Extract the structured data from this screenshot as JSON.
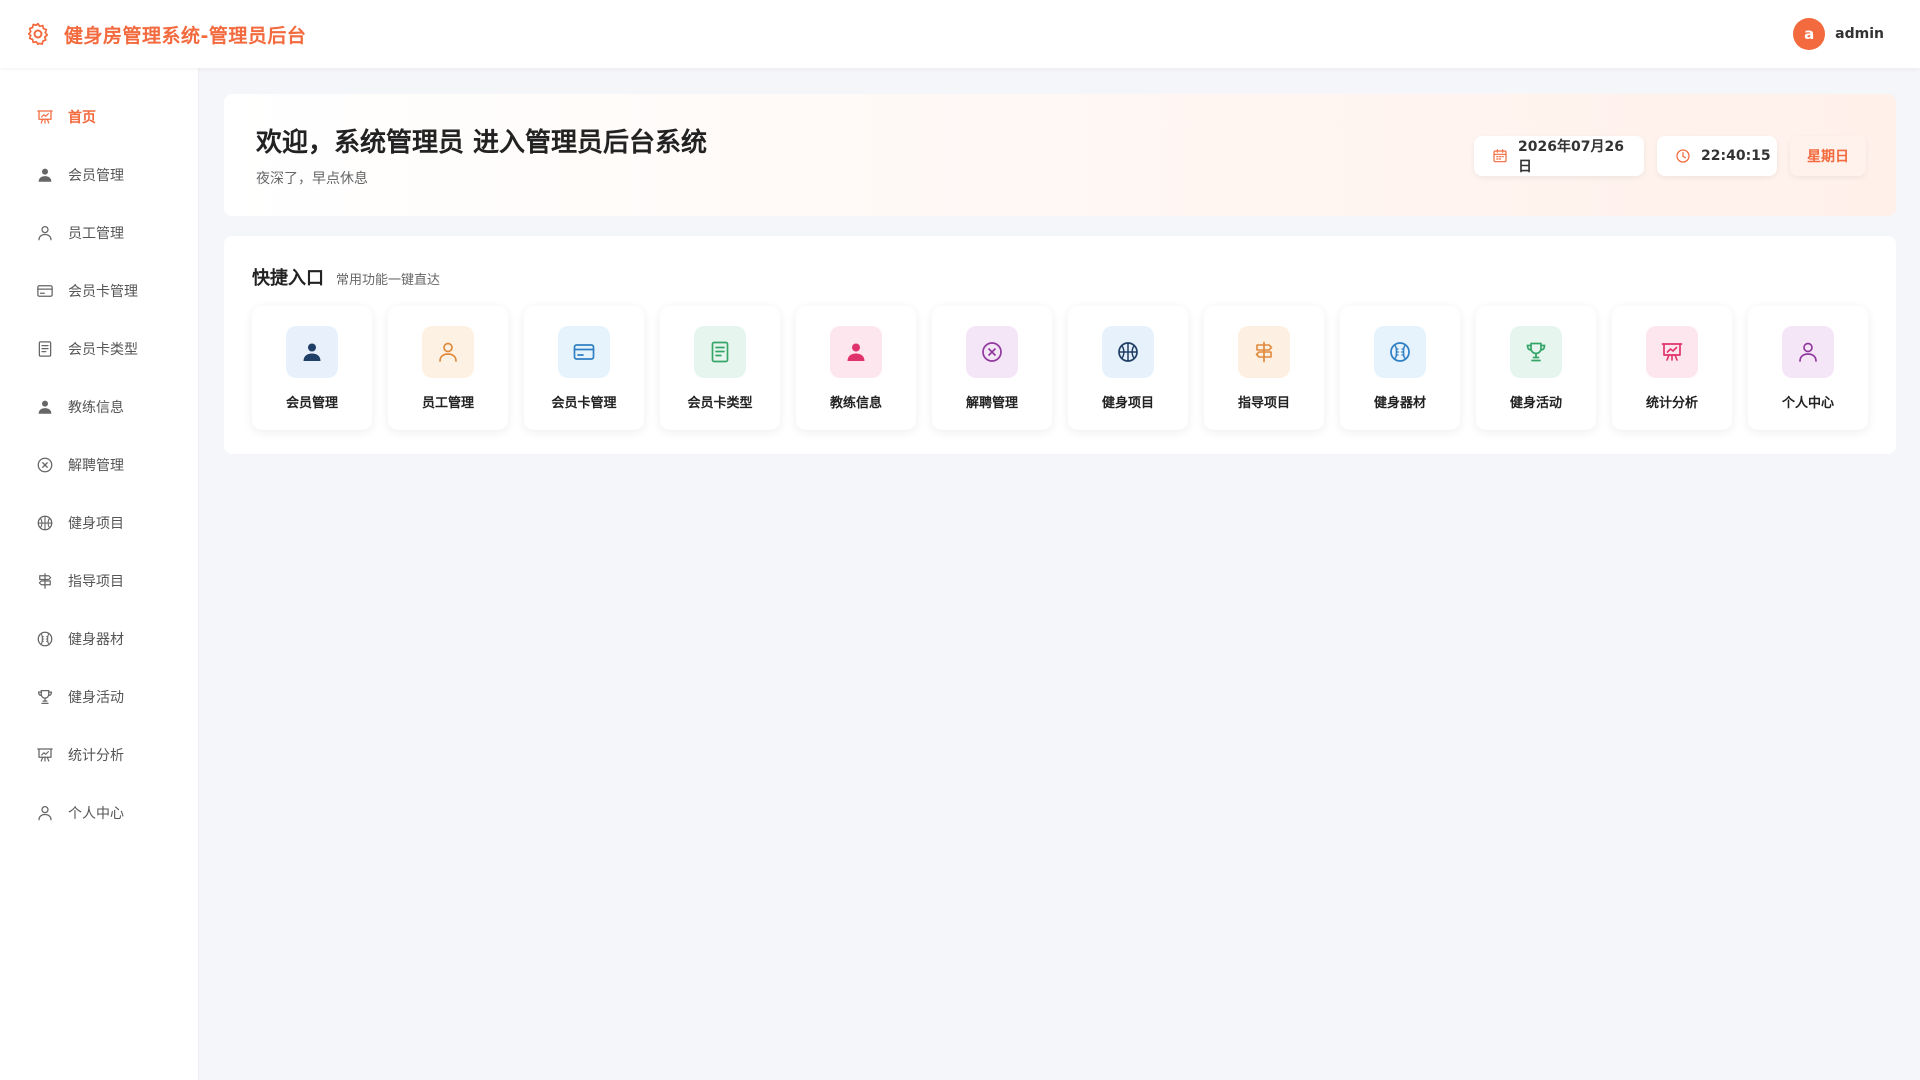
{
  "header": {
    "title": "健身房管理系统-管理员后台",
    "logo_icon": "gear-icon",
    "user_initial": "a",
    "username": "admin",
    "accent": "#f26a3d"
  },
  "sidebar": {
    "items": [
      {
        "label": "首页",
        "icon": "presentation-icon",
        "active": true
      },
      {
        "label": "会员管理",
        "icon": "user-solid-icon"
      },
      {
        "label": "员工管理",
        "icon": "user-outline-icon"
      },
      {
        "label": "会员卡管理",
        "icon": "credit-card-icon"
      },
      {
        "label": "会员卡类型",
        "icon": "document-icon"
      },
      {
        "label": "教练信息",
        "icon": "user-solid-icon"
      },
      {
        "label": "解聘管理",
        "icon": "circle-close-icon"
      },
      {
        "label": "健身项目",
        "icon": "basketball-icon"
      },
      {
        "label": "指导项目",
        "icon": "signpost-icon"
      },
      {
        "label": "健身器材",
        "icon": "baseball-icon"
      },
      {
        "label": "健身活动",
        "icon": "trophy-icon"
      },
      {
        "label": "统计分析",
        "icon": "presentation-icon"
      },
      {
        "label": "个人中心",
        "icon": "user-outline-icon"
      }
    ]
  },
  "welcome": {
    "heading": "欢迎，系统管理员 进入管理员后台系统",
    "subtext": "夜深了，早点休息",
    "date": "2026年07月26日",
    "time": "22:40:15",
    "weekday": "星期日"
  },
  "quick": {
    "title": "快捷入口",
    "subtitle": "常用功能一键直达",
    "tiles": [
      {
        "label": "会员管理",
        "icon": "user-solid-icon",
        "bg": "#e8f1fb",
        "color": "#1f3f66"
      },
      {
        "label": "员工管理",
        "icon": "user-outline-icon",
        "bg": "#fdf1e4",
        "color": "#e08a3c"
      },
      {
        "label": "会员卡管理",
        "icon": "credit-card-icon",
        "bg": "#e6f3fc",
        "color": "#2f7fc4"
      },
      {
        "label": "会员卡类型",
        "icon": "document-icon",
        "bg": "#e6f6ee",
        "color": "#35a56a"
      },
      {
        "label": "教练信息",
        "icon": "user-solid-icon",
        "bg": "#fde6ee",
        "color": "#e0336b"
      },
      {
        "label": "解聘管理",
        "icon": "circle-close-icon",
        "bg": "#f5e6f7",
        "color": "#8e3a9d"
      },
      {
        "label": "健身项目",
        "icon": "basketball-icon",
        "bg": "#e6f1fb",
        "color": "#1f3f66"
      },
      {
        "label": "指导项目",
        "icon": "signpost-icon",
        "bg": "#fdf0e2",
        "color": "#e08a3c"
      },
      {
        "label": "健身器材",
        "icon": "baseball-icon",
        "bg": "#e6f3fc",
        "color": "#2f7fc4"
      },
      {
        "label": "健身活动",
        "icon": "trophy-icon",
        "bg": "#e6f6ee",
        "color": "#35a56a"
      },
      {
        "label": "统计分析",
        "icon": "presentation-icon",
        "bg": "#fde6ee",
        "color": "#e0336b"
      },
      {
        "label": "个人中心",
        "icon": "user-outline-icon",
        "bg": "#f5e6f7",
        "color": "#8e3a9d"
      }
    ]
  }
}
